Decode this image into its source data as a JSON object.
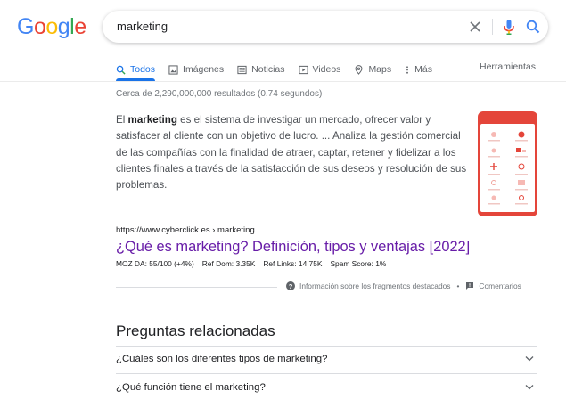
{
  "logo": {
    "letters": [
      "G",
      "o",
      "o",
      "g",
      "l",
      "e"
    ],
    "colors": [
      "#4285f4",
      "#ea4335",
      "#fbbc05",
      "#4285f4",
      "#34a853",
      "#ea4335"
    ]
  },
  "search": {
    "query": "marketing"
  },
  "tabs": [
    {
      "label": "Todos",
      "icon": "search-icon",
      "active": true
    },
    {
      "label": "Imágenes",
      "icon": "image-icon"
    },
    {
      "label": "Noticias",
      "icon": "news-icon"
    },
    {
      "label": "Videos",
      "icon": "video-icon"
    },
    {
      "label": "Maps",
      "icon": "map-pin-icon"
    },
    {
      "label": "Más",
      "icon": "more-dots-icon"
    }
  ],
  "tools_label": "Herramientas",
  "stats": "Cerca de 2,290,000,000 resultados (0.74 segundos)",
  "snippet": {
    "prefix": "El ",
    "bold": "marketing",
    "rest": " es el sistema de investigar un mercado, ofrecer valor y satisfacer al cliente con un objetivo de lucro. ... Analiza la gestión comercial de las compañías con la finalidad de atraer, captar, retener y fidelizar a los clientes finales a través de la satisfacción de sus deseos y resolución de sus problemas."
  },
  "result": {
    "url": "https://www.cyberclick.es › marketing",
    "title": "¿Qué es marketing? Definición, tipos y ventajas [2022]",
    "moz": [
      "MOZ DA: 55/100 (+4%)",
      "Ref Dom: 3.35K",
      "Ref Links: 14.75K",
      "Spam Score: 1%"
    ]
  },
  "snippet_footer": {
    "info": "Información sobre los fragmentos destacados",
    "separator": "•",
    "feedback": "Comentarios"
  },
  "related": {
    "title": "Preguntas relacionadas",
    "questions": [
      "¿Cuáles son los diferentes tipos de marketing?",
      "¿Qué función tiene el marketing?"
    ]
  },
  "colors": {
    "accent": "#1a73e8",
    "visited": "#681da8",
    "thumb": "#e4453a"
  }
}
